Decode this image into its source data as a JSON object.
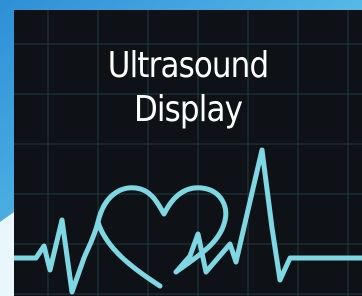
{
  "title": {
    "line1": "Ultrasound",
    "line2": "Display"
  },
  "colors": {
    "background": "#0e1216",
    "grid": "#1d3a40",
    "trace": "#7ed7e2",
    "title": "#ffffff",
    "corner_bg": "#3fa7e0"
  },
  "icons": [
    "heart-icon",
    "ecg-waveform-icon"
  ]
}
